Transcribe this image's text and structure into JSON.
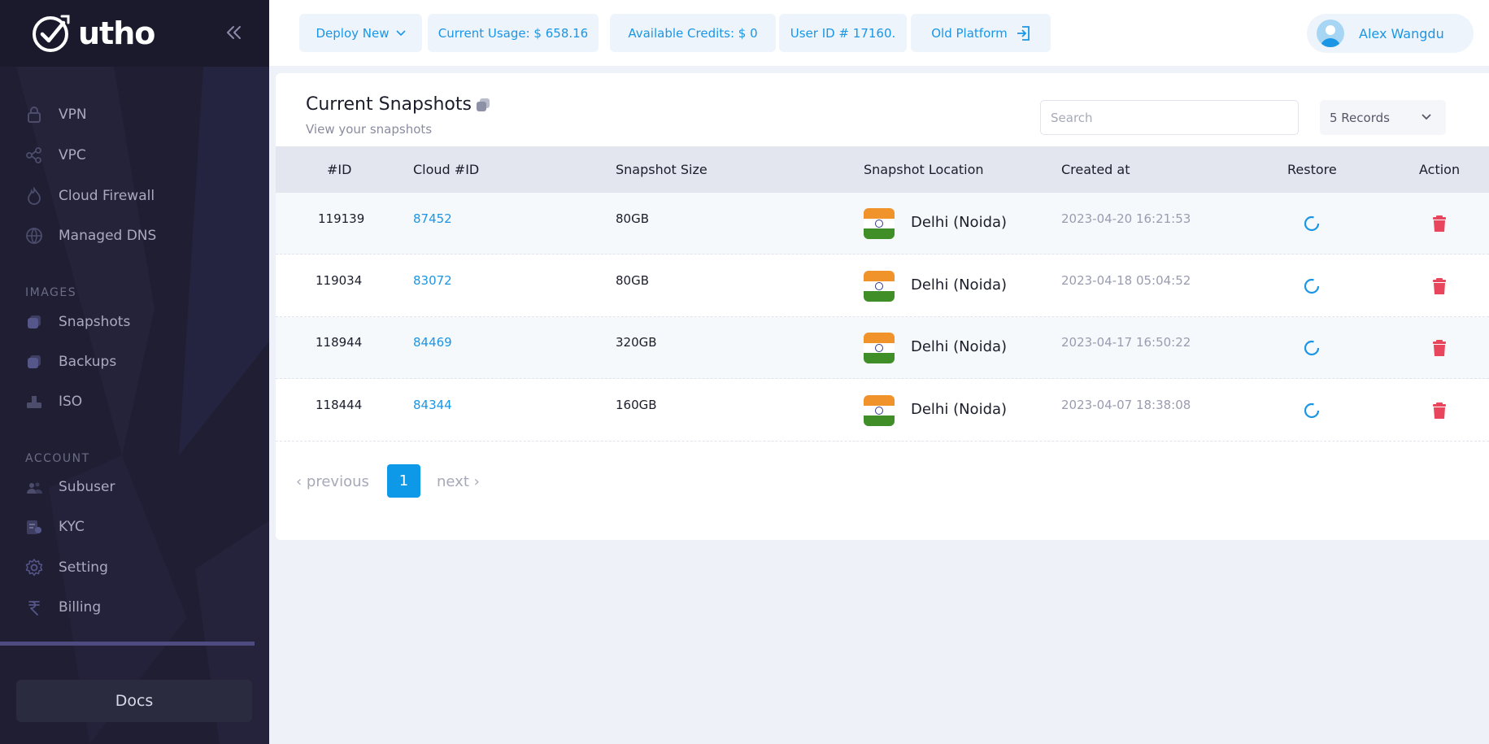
{
  "brand": {
    "name": "utho"
  },
  "sidebar": {
    "items": [
      {
        "label": "VPN",
        "icon": "lock-icon"
      },
      {
        "label": "VPC",
        "icon": "share-icon"
      },
      {
        "label": "Cloud Firewall",
        "icon": "fire-icon"
      },
      {
        "label": "Managed DNS",
        "icon": "globe-icon"
      }
    ],
    "images_section": "IMAGES",
    "images_items": [
      {
        "label": "Snapshots",
        "icon": "snapshot-icon"
      },
      {
        "label": "Backups",
        "icon": "backup-icon"
      },
      {
        "label": "ISO",
        "icon": "iso-icon"
      }
    ],
    "account_section": "ACCOUNT",
    "account_items": [
      {
        "label": "Subuser",
        "icon": "users-icon"
      },
      {
        "label": "KYC",
        "icon": "kyc-icon"
      },
      {
        "label": "Setting",
        "icon": "gear-icon"
      },
      {
        "label": "Billing",
        "icon": "rupee-icon"
      }
    ],
    "docs_label": "Docs"
  },
  "topbar": {
    "deploy_label": "Deploy New",
    "usage_label": "Current Usage: $ 658.16",
    "credits_label": "Available Credits: $ 0",
    "user_id_label": "User ID # 17160.",
    "old_platform_label": "Old Platform",
    "user_name": "Alex Wangdu"
  },
  "main": {
    "title": "Current Snapshots",
    "subtitle": "View your snapshots",
    "search_placeholder": "Search",
    "records_label": "5 Records",
    "columns": [
      "#ID",
      "Cloud #ID",
      "Snapshot Size",
      "Snapshot Location",
      "Created at",
      "Restore",
      "Action"
    ],
    "rows": [
      {
        "id": "119139",
        "cloud_id": "87452",
        "size": "80GB",
        "location": "Delhi (Noida)",
        "created": "2023-04-20 16:21:53"
      },
      {
        "id": "119034",
        "cloud_id": "83072",
        "size": "80GB",
        "location": "Delhi (Noida)",
        "created": "2023-04-18 05:04:52"
      },
      {
        "id": "118944",
        "cloud_id": "84469",
        "size": "320GB",
        "location": "Delhi (Noida)",
        "created": "2023-04-17 16:50:22"
      },
      {
        "id": "118444",
        "cloud_id": "84344",
        "size": "160GB",
        "location": "Delhi (Noida)",
        "created": "2023-04-07 18:38:08"
      }
    ],
    "pagination": {
      "previous": "‹ previous",
      "current": "1",
      "next": "next ›"
    }
  },
  "colors": {
    "accent": "#1a96e5",
    "sidebar_bg": "#1f1e33",
    "delete": "#e8465c"
  }
}
